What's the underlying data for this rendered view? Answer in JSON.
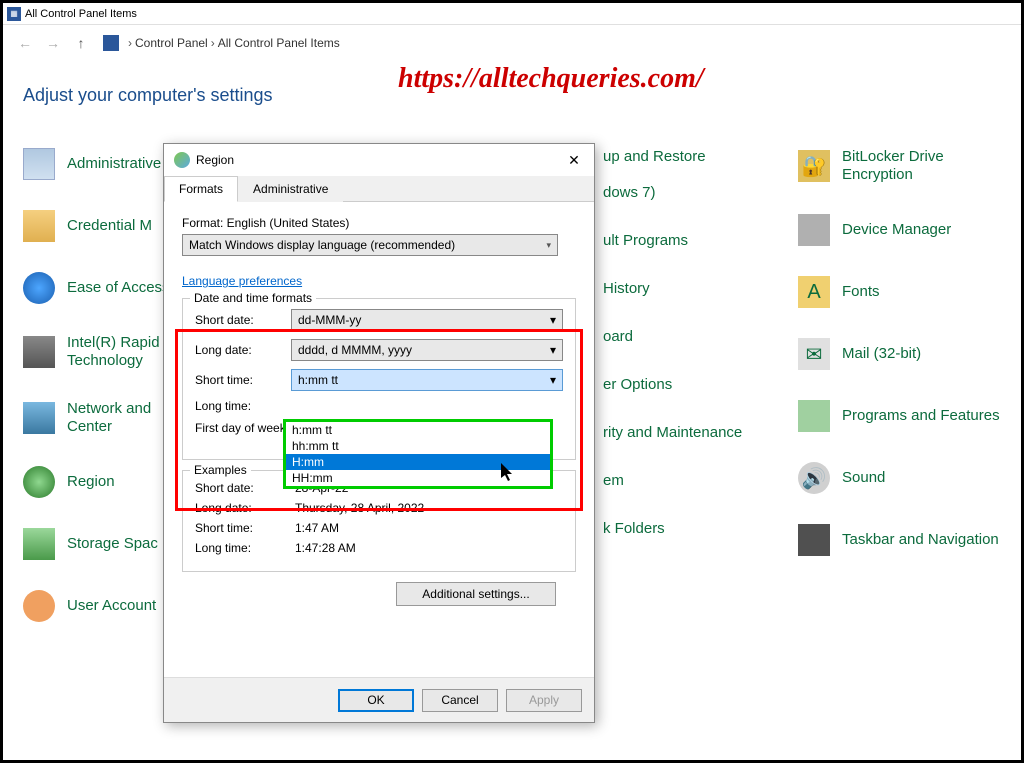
{
  "window_title": "All Control Panel Items",
  "breadcrumb": {
    "part1": "Control Panel",
    "part2": "All Control Panel Items"
  },
  "watermark": "https://alltechqueries.com/",
  "heading": "Adjust your computer's settings",
  "col1": [
    {
      "label": "Administrative"
    },
    {
      "label": "Credential M"
    },
    {
      "label": "Ease of Access"
    },
    {
      "label": "Intel(R) Rapid\nTechnology"
    },
    {
      "label": "Network and\nCenter"
    },
    {
      "label": "Region"
    },
    {
      "label": "Storage Spac"
    },
    {
      "label": "User Account"
    }
  ],
  "col2": [
    {
      "label": "up and Restore\n\ndows 7)"
    },
    {
      "label": "ult Programs"
    },
    {
      "label": "History"
    },
    {
      "label": "oard"
    },
    {
      "label": "er Options"
    },
    {
      "label": "rity and Maintenance"
    },
    {
      "label": "em"
    },
    {
      "label": "k Folders"
    }
  ],
  "col3": [
    {
      "label": "BitLocker Drive Encryption"
    },
    {
      "label": "Device Manager"
    },
    {
      "label": "Fonts"
    },
    {
      "label": "Mail (32-bit)"
    },
    {
      "label": "Programs and Features"
    },
    {
      "label": "Sound"
    },
    {
      "label": "Taskbar and Navigation"
    }
  ],
  "dialog": {
    "title": "Region",
    "tab1": "Formats",
    "tab2": "Administrative",
    "format_label": "Format: English (United States)",
    "format_value": "Match Windows display language (recommended)",
    "lang_pref": "Language preferences",
    "fieldset1_legend": "Date and time formats",
    "short_date_l": "Short date:",
    "short_date_v": "dd-MMM-yy",
    "long_date_l": "Long date:",
    "long_date_v": "dddd, d MMMM, yyyy",
    "short_time_l": "Short time:",
    "short_time_v": "h:mm tt",
    "long_time_l": "Long time:",
    "first_day_l": "First day of week:",
    "dropdown_options": {
      "o1": "h:mm tt",
      "o2": "hh:mm tt",
      "o3": "H:mm",
      "o4": "HH:mm"
    },
    "fieldset2_legend": "Examples",
    "ex_short_date_l": "Short date:",
    "ex_short_date_v": "28-Apr-22",
    "ex_long_date_l": "Long date:",
    "ex_long_date_v": "Thursday, 28 April, 2022",
    "ex_short_time_l": "Short time:",
    "ex_short_time_v": "1:47 AM",
    "ex_long_time_l": "Long time:",
    "ex_long_time_v": "1:47:28 AM",
    "additional": "Additional settings...",
    "ok": "OK",
    "cancel": "Cancel",
    "apply": "Apply"
  }
}
